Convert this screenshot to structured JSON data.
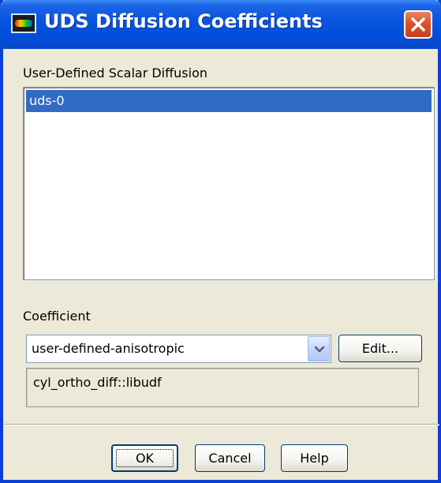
{
  "window": {
    "title": "UDS Diffusion Coefficients",
    "app_icon": "fluent-app-icon",
    "close_icon": "close-icon"
  },
  "scalar_list": {
    "label": "User-Defined Scalar Diffusion",
    "items": [
      {
        "label": "uds-0",
        "selected": true
      }
    ]
  },
  "coefficient": {
    "label": "Coefficient",
    "selected_value": "user-defined-anisotropic",
    "dropdown_icon": "chevron-down-icon",
    "edit_label": "Edit...",
    "function_value": "cyl_ortho_diff::libudf"
  },
  "buttons": {
    "ok_label": "OK",
    "cancel_label": "Cancel",
    "help_label": "Help"
  },
  "colors": {
    "titlebar": "#0a55e0",
    "selection": "#316ac5",
    "dialog_bg": "#ece9d8",
    "close_button": "#d9502a"
  }
}
